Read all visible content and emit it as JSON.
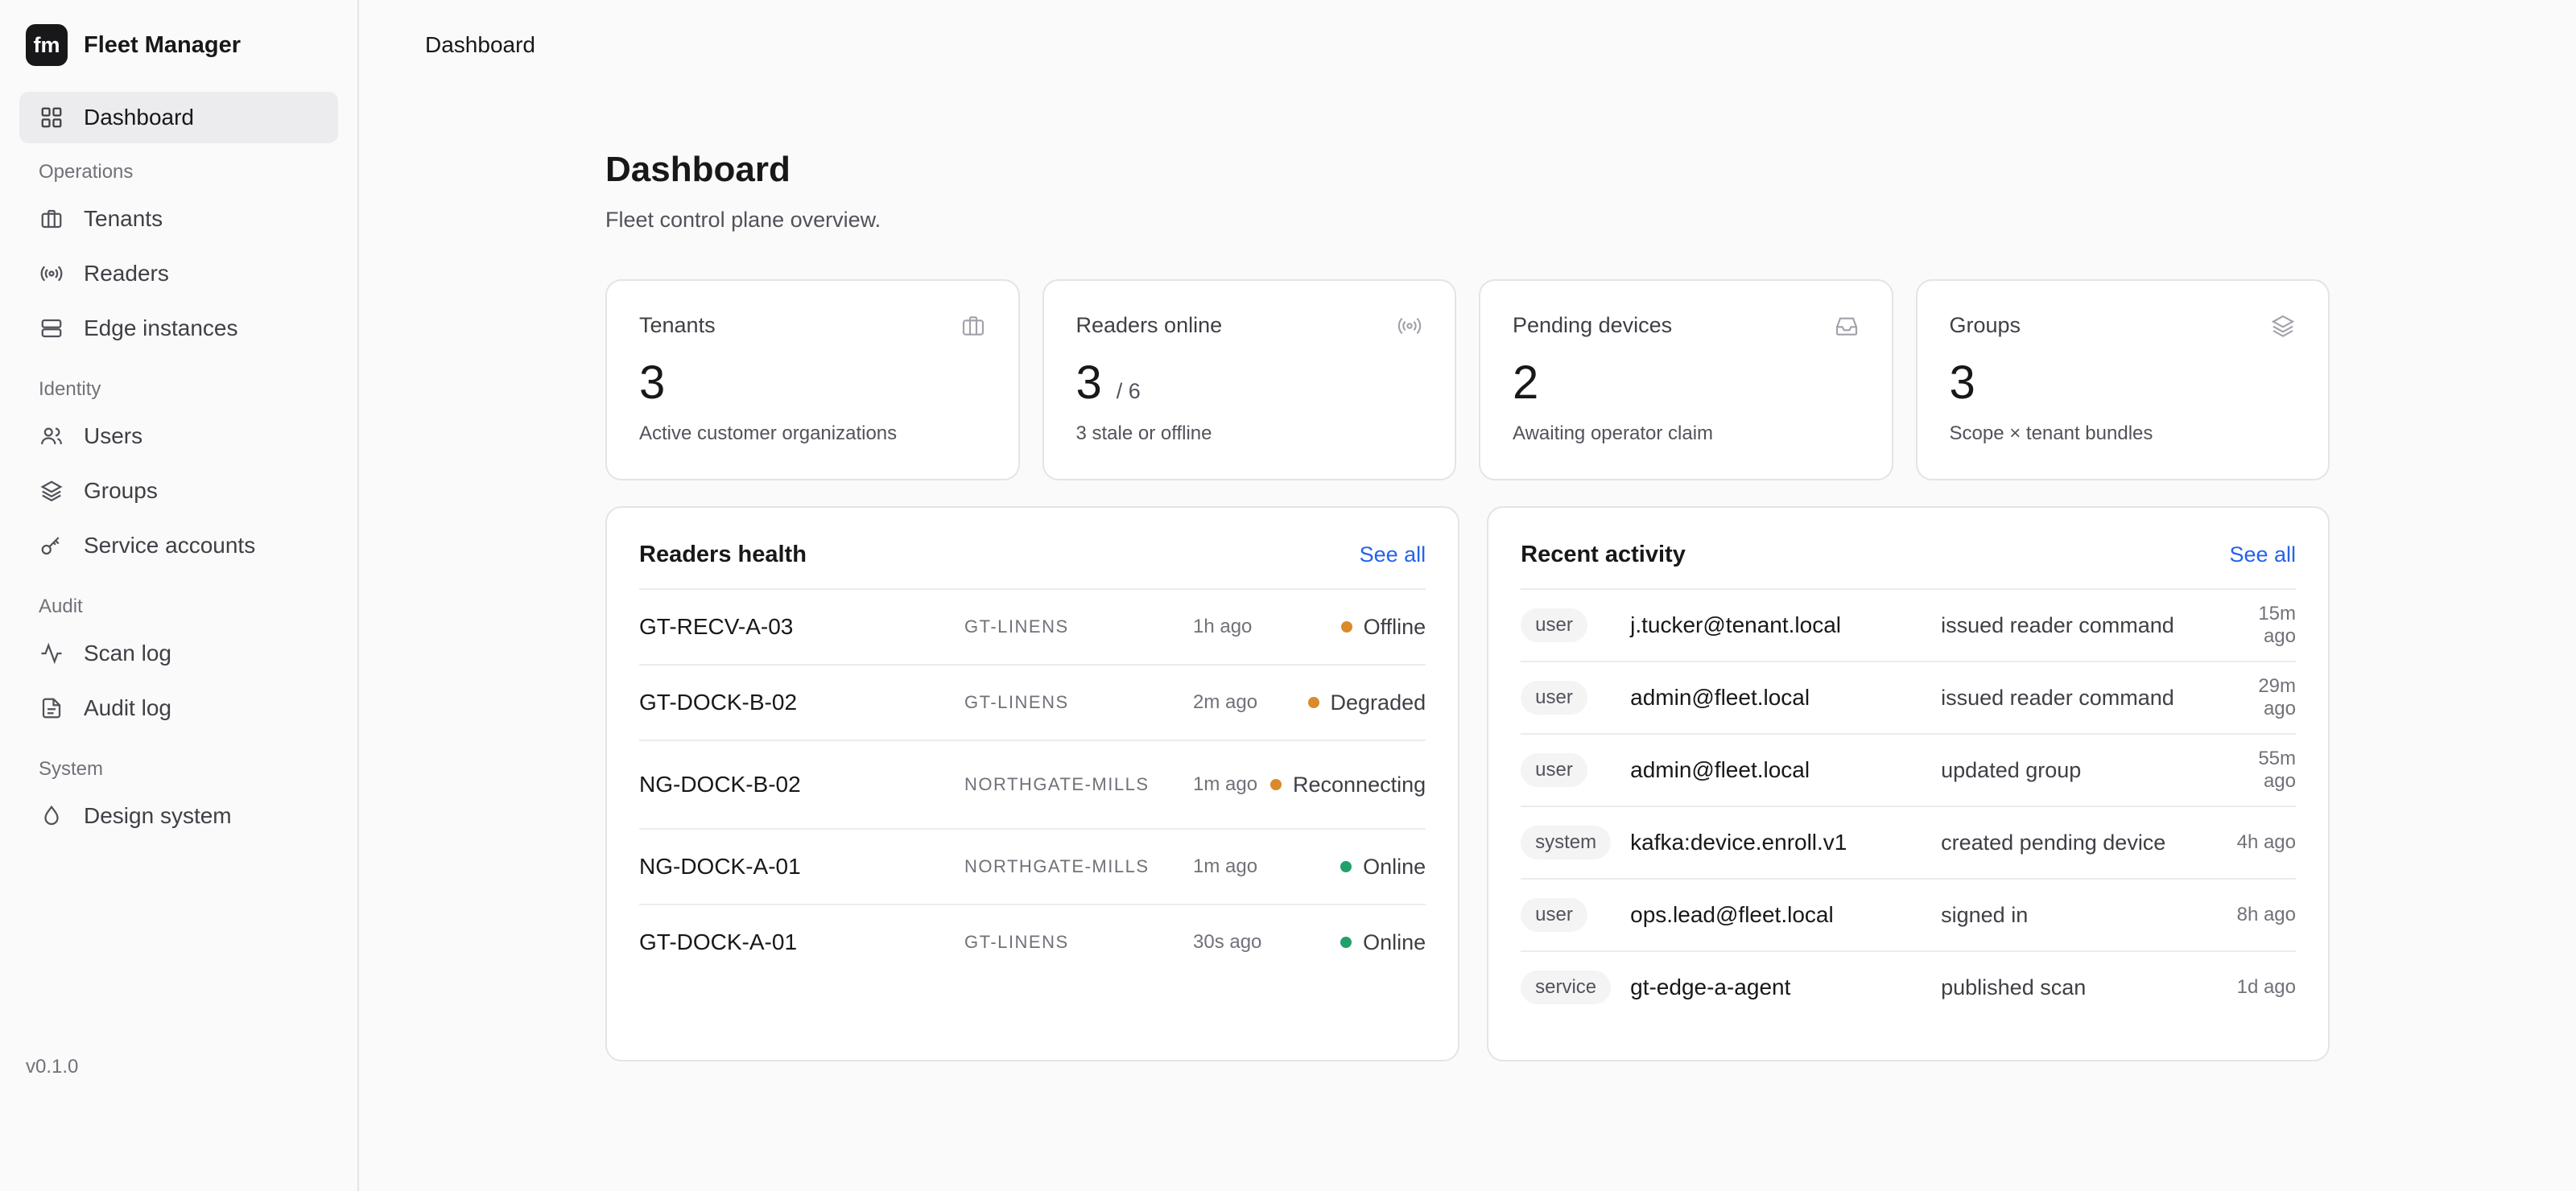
{
  "app": {
    "logo_text": "fm",
    "name": "Fleet Manager",
    "version": "v0.1.0"
  },
  "sidebar": {
    "dashboard": {
      "label": "Dashboard",
      "icon": "grid-icon",
      "active": true
    },
    "sections": [
      {
        "title": "Operations",
        "items": [
          {
            "label": "Tenants",
            "icon": "briefcase-icon"
          },
          {
            "label": "Readers",
            "icon": "radio-icon"
          },
          {
            "label": "Edge instances",
            "icon": "server-icon"
          }
        ]
      },
      {
        "title": "Identity",
        "items": [
          {
            "label": "Users",
            "icon": "users-icon"
          },
          {
            "label": "Groups",
            "icon": "layers-icon"
          },
          {
            "label": "Service accounts",
            "icon": "key-icon"
          }
        ]
      },
      {
        "title": "Audit",
        "items": [
          {
            "label": "Scan log",
            "icon": "activity-icon"
          },
          {
            "label": "Audit log",
            "icon": "file-text-icon"
          }
        ]
      },
      {
        "title": "System",
        "items": [
          {
            "label": "Design system",
            "icon": "droplet-icon"
          }
        ]
      }
    ]
  },
  "topbar": {
    "breadcrumb": "Dashboard"
  },
  "page": {
    "title": "Dashboard",
    "subtitle": "Fleet control plane overview."
  },
  "stats": [
    {
      "label": "Tenants",
      "value": "3",
      "total": "",
      "caption": "Active customer organizations",
      "icon": "briefcase-icon"
    },
    {
      "label": "Readers online",
      "value": "3",
      "total": "/ 6",
      "caption": "3 stale or offline",
      "icon": "radio-icon"
    },
    {
      "label": "Pending devices",
      "value": "2",
      "total": "",
      "caption": "Awaiting operator claim",
      "icon": "inbox-icon"
    },
    {
      "label": "Groups",
      "value": "3",
      "total": "",
      "caption": "Scope × tenant bundles",
      "icon": "layers-icon"
    }
  ],
  "readers_health": {
    "title": "Readers health",
    "see_all": "See all",
    "rows": [
      {
        "name": "GT-RECV-A-03",
        "tenant": "GT-LINENS",
        "time": "1h ago",
        "status": "Offline",
        "color": "#d98a2b"
      },
      {
        "name": "GT-DOCK-B-02",
        "tenant": "GT-LINENS",
        "time": "2m ago",
        "status": "Degraded",
        "color": "#d98a2b"
      },
      {
        "name": "NG-DOCK-B-02",
        "tenant": "NORTHGATE-MILLS",
        "time": "1m ago",
        "status": "Reconnecting",
        "color": "#d98a2b"
      },
      {
        "name": "NG-DOCK-A-01",
        "tenant": "NORTHGATE-MILLS",
        "time": "1m ago",
        "status": "Online",
        "color": "#22a06b"
      },
      {
        "name": "GT-DOCK-A-01",
        "tenant": "GT-LINENS",
        "time": "30s ago",
        "status": "Online",
        "color": "#22a06b"
      }
    ]
  },
  "recent_activity": {
    "title": "Recent activity",
    "see_all": "See all",
    "rows": [
      {
        "type": "user",
        "actor": "j.tucker@tenant.local",
        "action": "issued reader command",
        "when": "15m ago"
      },
      {
        "type": "user",
        "actor": "admin@fleet.local",
        "action": "issued reader command",
        "when": "29m ago"
      },
      {
        "type": "user",
        "actor": "admin@fleet.local",
        "action": "updated group",
        "when": "55m ago"
      },
      {
        "type": "system",
        "actor": "kafka:device.enroll.v1",
        "action": "created pending device",
        "when": "4h ago"
      },
      {
        "type": "user",
        "actor": "ops.lead@fleet.local",
        "action": "signed in",
        "when": "8h ago"
      },
      {
        "type": "service",
        "actor": "gt-edge-a-agent",
        "action": "published scan",
        "when": "1d ago"
      }
    ]
  }
}
